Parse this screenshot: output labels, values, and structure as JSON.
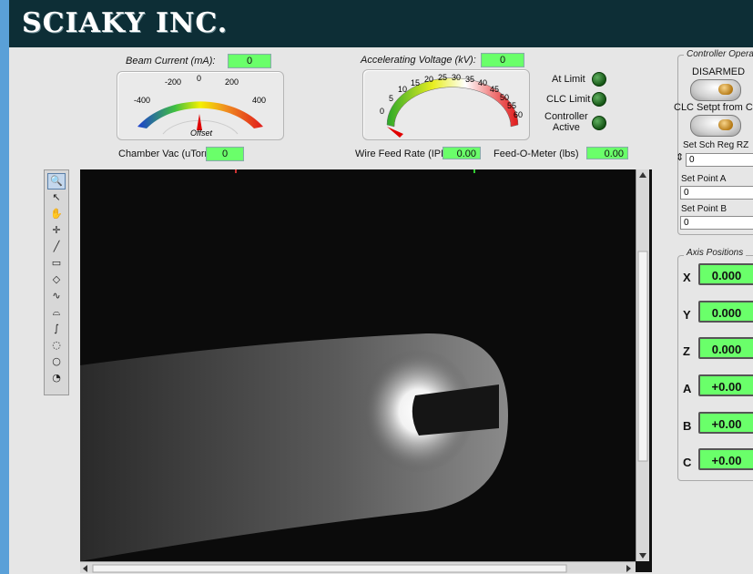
{
  "app": {
    "logo_text": "SCIAKY INC."
  },
  "gauges": {
    "beam_current": {
      "label": "Beam Current (mA):",
      "value": "0",
      "ticks": [
        "-400",
        "-200",
        "0",
        "200",
        "400"
      ],
      "sublabel": "Offset"
    },
    "accel_voltage": {
      "label": "Accelerating Voltage (kV):",
      "value": "0",
      "ticks": [
        "0",
        "5",
        "10",
        "15",
        "20",
        "25",
        "30",
        "35",
        "40",
        "45",
        "50",
        "55",
        "60"
      ]
    }
  },
  "readouts": {
    "chamber_vac": {
      "label": "Chamber Vac (uTorr)",
      "value": "0"
    },
    "wire_feed": {
      "label": "Wire Feed Rate (IPM)",
      "value": "0.00"
    },
    "feed_o_meter": {
      "label": "Feed-O-Meter (lbs)",
      "value": "0.00"
    }
  },
  "indicators": {
    "at_limit": "At Limit",
    "clc_limit": "CLC Limit",
    "controller_active_1": "Controller",
    "controller_active_2": "Active"
  },
  "controller": {
    "title": "Controller Opera",
    "armed_state": "DISARMED",
    "clc_setpt": "CLC Setpt from CN",
    "set_sch_label": "Set Sch Reg RZ",
    "set_sch_value": "0",
    "set_point_a_label": "Set Point A",
    "set_point_a_value": "0",
    "set_point_b_label": "Set Point B",
    "set_point_b_value": "0"
  },
  "axis_positions": {
    "title": "Axis Positions",
    "axes": [
      {
        "letter": "X",
        "value": "0.000"
      },
      {
        "letter": "Y",
        "value": "0.000"
      },
      {
        "letter": "Z",
        "value": "0.000"
      },
      {
        "letter": "A",
        "value": "+0.00"
      },
      {
        "letter": "B",
        "value": "+0.00"
      },
      {
        "letter": "C",
        "value": "+0.00"
      }
    ]
  },
  "tools": [
    {
      "name": "zoom-tool-icon",
      "glyph": "🔍"
    },
    {
      "name": "pointer-tool-icon",
      "glyph": "↖"
    },
    {
      "name": "pan-tool-icon",
      "glyph": "✋"
    },
    {
      "name": "crosshair-tool-icon",
      "glyph": "✛"
    },
    {
      "name": "line-tool-icon",
      "glyph": "╱"
    },
    {
      "name": "rectangle-tool-icon",
      "glyph": "▭"
    },
    {
      "name": "rotated-rect-tool-icon",
      "glyph": "◇"
    },
    {
      "name": "polyline-tool-icon",
      "glyph": "∿"
    },
    {
      "name": "polygon-tool-icon",
      "glyph": "⌓"
    },
    {
      "name": "freehand-tool-icon",
      "glyph": "∫"
    },
    {
      "name": "freehand-region-tool-icon",
      "glyph": "◌"
    },
    {
      "name": "oval-tool-icon",
      "glyph": "○"
    },
    {
      "name": "annulus-tool-icon",
      "glyph": "◔"
    }
  ],
  "colors": {
    "title_bar": "#0d2e36",
    "led_green": "#1f7a1f",
    "numeric_green": "#6aff6a"
  }
}
